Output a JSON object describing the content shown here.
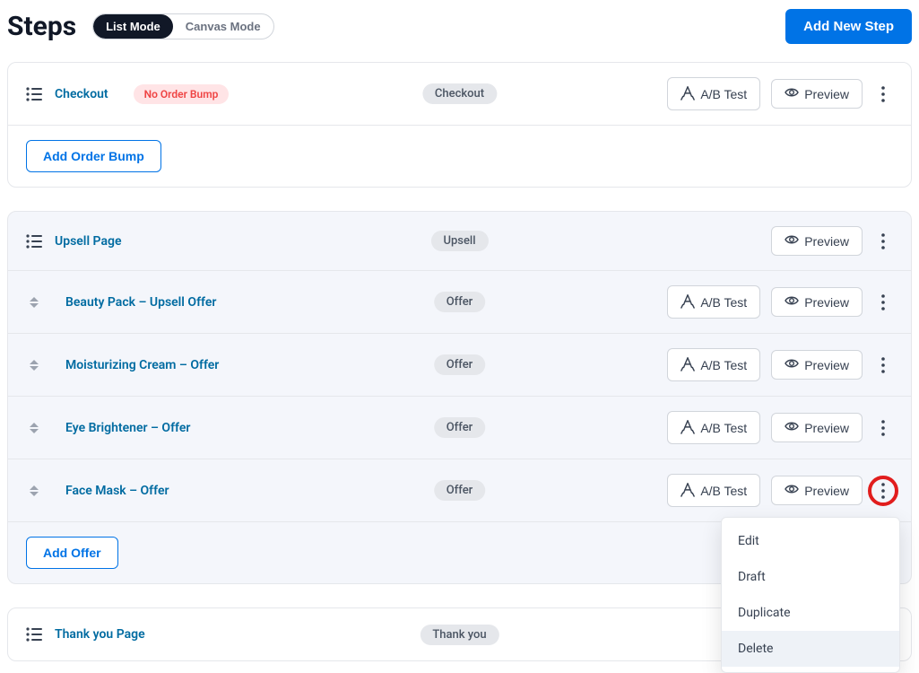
{
  "header": {
    "title": "Steps",
    "mode_list": "List Mode",
    "mode_canvas": "Canvas Mode",
    "add_step": "Add New Step"
  },
  "buttons": {
    "abtest": "A/B Test",
    "preview": "Preview",
    "add_bump": "Add Order Bump",
    "add_offer": "Add Offer"
  },
  "badges": {
    "no_bump": "No Order Bump",
    "checkout": "Checkout",
    "upsell": "Upsell",
    "offer": "Offer",
    "thankyou": "Thank you"
  },
  "menu": {
    "edit": "Edit",
    "draft": "Draft",
    "duplicate": "Duplicate",
    "delete": "Delete"
  },
  "steps": {
    "checkout": {
      "name": "Checkout"
    },
    "upsell_page": {
      "name": "Upsell Page"
    },
    "offer1": {
      "name": "Beauty Pack – Upsell Offer"
    },
    "offer2": {
      "name": "Moisturizing Cream – Offer"
    },
    "offer3": {
      "name": "Eye Brightener – Offer"
    },
    "offer4": {
      "name": "Face Mask – Offer"
    },
    "thankyou": {
      "name": "Thank you Page"
    }
  }
}
